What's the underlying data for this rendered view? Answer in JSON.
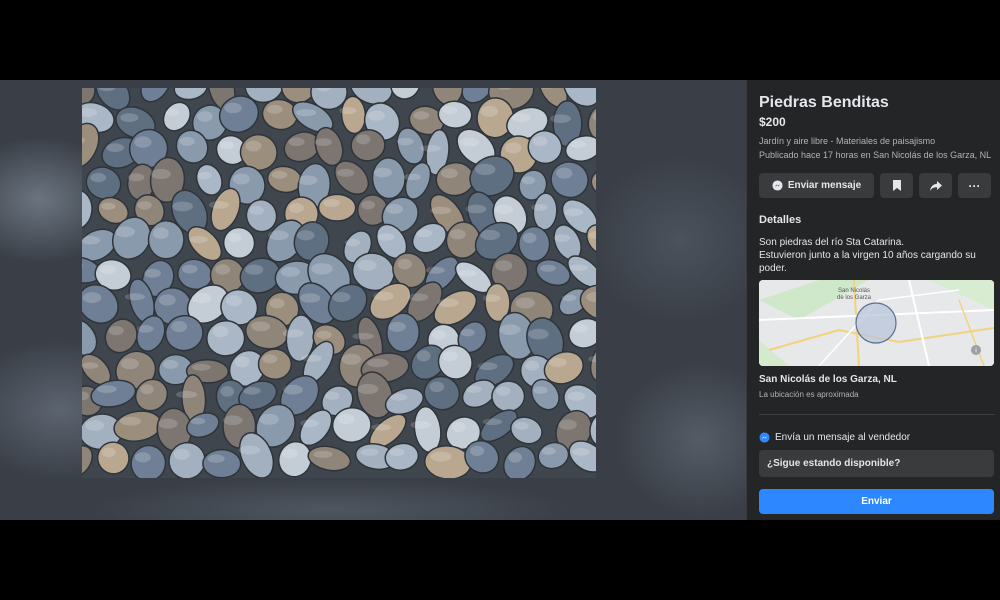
{
  "listing": {
    "title": "Piedras Benditas",
    "price": "$200",
    "category": "Jardín y aire libre - Materiales de paisajismo",
    "posted": "Publicado hace 17 horas en San Nicolás de los Garza, NL"
  },
  "actions": {
    "message_label": "Enviar mensaje",
    "save_icon": "bookmark-icon",
    "share_icon": "share-icon",
    "more_icon": "more-icon",
    "more_glyph": "···"
  },
  "details": {
    "heading": "Detalles",
    "description": "Son piedras del río Sta Catarina.\nEstuvieron junto a la virgen 10 años cargando su poder."
  },
  "map": {
    "label_line1": "San Nicolás",
    "label_line2": "de los Garza"
  },
  "location": {
    "name": "San Nicolás de los Garza, NL",
    "note": "La ubicación es aproximada"
  },
  "message": {
    "heading": "Envía un mensaje al vendedor",
    "input_value": "¿Sigue estando disponible?",
    "send_label": "Enviar"
  },
  "colors": {
    "panel_bg": "#242526",
    "button_bg": "#3a3b3c",
    "accent": "#2d88ff"
  }
}
